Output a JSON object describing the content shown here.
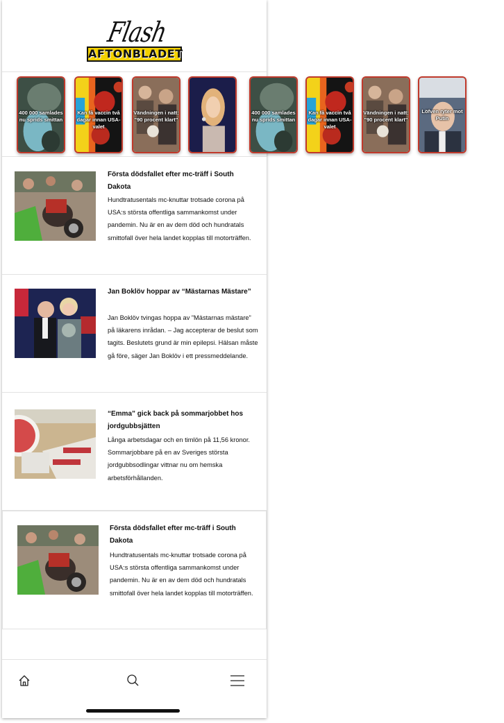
{
  "header": {
    "logo_script": "Flash",
    "logo_brand": "AFTONBLADET"
  },
  "stories": [
    {
      "caption": "400 000 samlades nu sprids smittan",
      "theme": "gloves"
    },
    {
      "caption": "Kan få vaccin två dagar innan USA-valet",
      "theme": "virus"
    },
    {
      "caption": "Vändningen i natt: \"90 procent klart\"",
      "theme": "crowd"
    },
    {
      "caption": "",
      "theme": "singer"
    },
    {
      "caption": "400 000 samlades nu sprids smittan",
      "theme": "gloves"
    },
    {
      "caption": "Kan få vaccin två dagar innan USA-valet",
      "theme": "virus"
    },
    {
      "caption": "Vändningen i natt: \"90 procent klart\"",
      "theme": "crowd"
    },
    {
      "caption": "Löfven ryter mot Putin",
      "theme": "politician"
    }
  ],
  "articles": [
    {
      "title": "Första dödsfallet efter mc-träff i South Dakota",
      "body": "Hundtratusentals mc-knuttar trotsade corona på USA:s största offentliga sammankomst under pandemin. Nu är en av dem död och hundratals smittofall över hela landet kopplas till motorträffen.",
      "image": "motorcycles"
    },
    {
      "title": "Jan Boklöv hoppar av “Mästarnas Mästare”",
      "body": "Jan Boklöv tvingas hoppa av ”Mästarnas mästare” på läkarens inrådan. – Jag accepterar de beslut som tagits. Beslutets grund är min epilepsi. Hälsan måste gå före, säger Jan Boklöv i ett pressmeddelande.",
      "image": "couple"
    },
    {
      "title": "“Emma” gick back på sommarjobbet hos jordgubbsjätten",
      "body": "Långa arbetsdagar och en timlön på 11,56 kronor. Sommarjobbare på en av Sveriges största jordgubbsodlingar vittnar nu om hemska arbetsförhållanden.",
      "image": "farm"
    },
    {
      "title": "Första dödsfallet efter mc-träff i South Dakota",
      "body": "Hundtratusentals mc-knuttar trotsade corona på USA:s största offentliga sammankomst under pandemin. Nu är en av dem död och hundratals smittofall över hela landet kopplas till motorträffen.",
      "image": "motorcycles"
    }
  ],
  "nav": {
    "home": "home-icon",
    "search": "search-icon",
    "menu": "menu-icon"
  },
  "colors": {
    "story_border": "#c0392b",
    "brand_yellow": "#f3d000"
  }
}
